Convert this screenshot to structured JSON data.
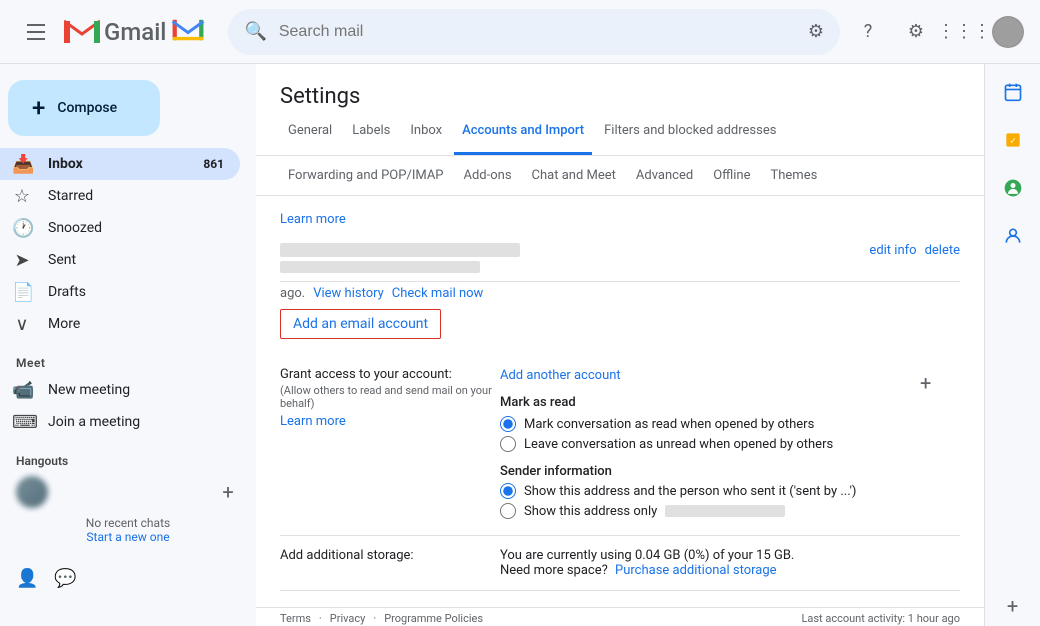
{
  "topbar": {
    "search_placeholder": "Search mail",
    "app_name": "Gmail"
  },
  "sidebar": {
    "compose_label": "Compose",
    "nav_items": [
      {
        "id": "inbox",
        "label": "Inbox",
        "count": "861",
        "active": true
      },
      {
        "id": "starred",
        "label": "Starred",
        "count": "",
        "active": false
      },
      {
        "id": "snoozed",
        "label": "Snoozed",
        "count": "",
        "active": false
      },
      {
        "id": "sent",
        "label": "Sent",
        "count": "",
        "active": false
      },
      {
        "id": "drafts",
        "label": "Drafts",
        "count": "",
        "active": false
      },
      {
        "id": "more",
        "label": "More",
        "count": "",
        "active": false
      }
    ],
    "meet_label": "Meet",
    "new_meeting_label": "New meeting",
    "join_meeting_label": "Join a meeting",
    "hangouts_label": "Hangouts",
    "no_recent_label": "No recent chats",
    "start_new_label": "Start a new one"
  },
  "settings": {
    "title": "Settings",
    "tabs": [
      {
        "id": "general",
        "label": "General",
        "active": false
      },
      {
        "id": "labels",
        "label": "Labels",
        "active": false
      },
      {
        "id": "inbox",
        "label": "Inbox",
        "active": false
      },
      {
        "id": "accounts",
        "label": "Accounts and Import",
        "active": true
      },
      {
        "id": "filters",
        "label": "Filters and blocked addresses",
        "active": false
      }
    ],
    "subtabs": [
      {
        "id": "forwarding",
        "label": "Forwarding and POP/IMAP"
      },
      {
        "id": "addons",
        "label": "Add-ons"
      },
      {
        "id": "chat",
        "label": "Chat and Meet"
      },
      {
        "id": "advanced",
        "label": "Advanced"
      },
      {
        "id": "offline",
        "label": "Offline"
      },
      {
        "id": "themes",
        "label": "Themes"
      }
    ],
    "learn_more_1": "Learn more",
    "learn_more_2": "Learn more",
    "edit_info": "edit info",
    "delete": "delete",
    "view_history": "View history",
    "check_mail": "Check mail now",
    "ago_text": "ago.",
    "add_email_btn": "Add an email account",
    "grant_access_label": "Grant access to your account:",
    "grant_access_sub": "(Allow others to read and send mail on your behalf)",
    "add_another": "Add another account",
    "mark_as_read_label": "Mark as read",
    "mark_conv_read": "Mark conversation as read when opened by others",
    "leave_conv_unread": "Leave conversation as unread when opened by others",
    "sender_info_label": "Sender information",
    "show_address_person": "Show this address and the person who sent it ('sent by ...')",
    "show_address_only": "Show this address only",
    "add_storage_label": "Add additional storage:",
    "storage_text": "You are currently using 0.04 GB (0%) of your 15 GB.",
    "need_more": "Need more space?",
    "purchase_storage": "Purchase additional storage"
  },
  "footer": {
    "terms": "Terms",
    "privacy": "Privacy",
    "programme": "Programme Policies",
    "last_activity": "Last account activity: 1 hour ago"
  }
}
